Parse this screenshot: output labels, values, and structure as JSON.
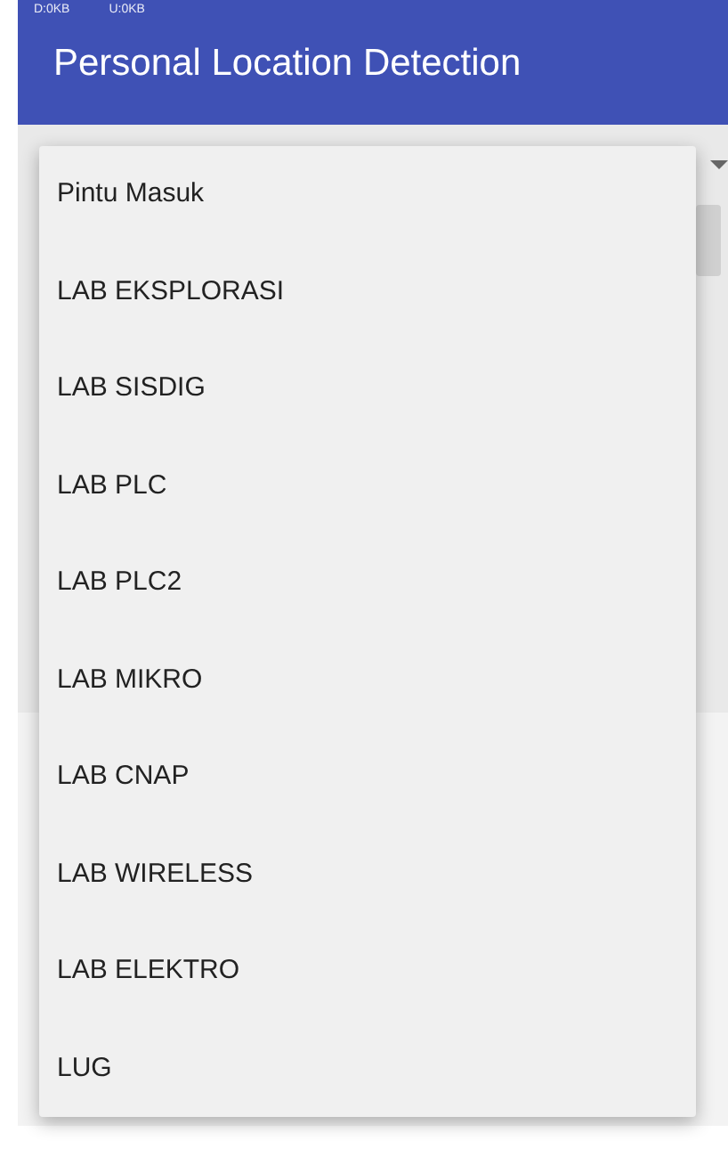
{
  "status_bar": {
    "download": "D:0KB",
    "upload": "U:0KB"
  },
  "app_bar": {
    "title": "Personal Location Detection"
  },
  "dropdown": {
    "items": [
      {
        "label": "Pintu Masuk"
      },
      {
        "label": "LAB EKSPLORASI"
      },
      {
        "label": "LAB SISDIG"
      },
      {
        "label": "LAB PLC"
      },
      {
        "label": "LAB PLC2"
      },
      {
        "label": "LAB MIKRO"
      },
      {
        "label": "LAB CNAP"
      },
      {
        "label": "LAB WIRELESS"
      },
      {
        "label": "LAB ELEKTRO"
      },
      {
        "label": "LUG"
      }
    ]
  }
}
